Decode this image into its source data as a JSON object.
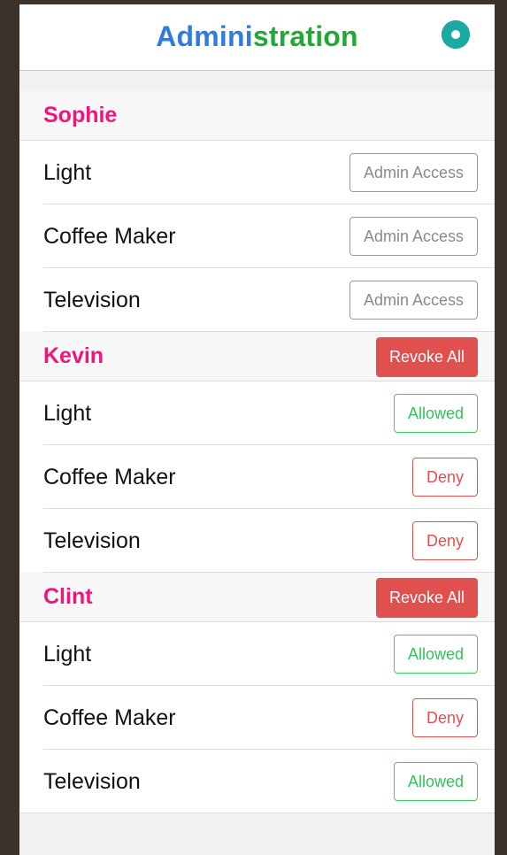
{
  "navbar": {
    "title_part1": "Admini",
    "title_part2": "stration",
    "title_color1": "#2f7be5",
    "title_color2": "#22a934",
    "settings_icon": "gear-icon",
    "settings_icon_color": "#1aa9a3"
  },
  "colors": {
    "user_name": "#f2147e",
    "revoke_bg": "#e0504f",
    "allowed": "#2ec55a",
    "deny": "#e0504f",
    "admin": "#8a8a8a"
  },
  "users": [
    {
      "name": "Sophie",
      "revoke_label": "",
      "devices": [
        {
          "name": "Light",
          "action": "Admin Access",
          "kind": "admin"
        },
        {
          "name": "Coffee Maker",
          "action": "Admin Access",
          "kind": "admin"
        },
        {
          "name": "Television",
          "action": "Admin Access",
          "kind": "admin"
        }
      ]
    },
    {
      "name": "Kevin",
      "revoke_label": "Revoke All",
      "devices": [
        {
          "name": "Light",
          "action": "Allowed",
          "kind": "allowed"
        },
        {
          "name": "Coffee Maker",
          "action": "Deny",
          "kind": "deny"
        },
        {
          "name": "Television",
          "action": "Deny",
          "kind": "deny"
        }
      ]
    },
    {
      "name": "Clint",
      "revoke_label": "Revoke All",
      "devices": [
        {
          "name": "Light",
          "action": "Allowed",
          "kind": "allowed"
        },
        {
          "name": "Coffee Maker",
          "action": "Deny",
          "kind": "deny"
        },
        {
          "name": "Television",
          "action": "Allowed",
          "kind": "allowed"
        }
      ]
    }
  ]
}
